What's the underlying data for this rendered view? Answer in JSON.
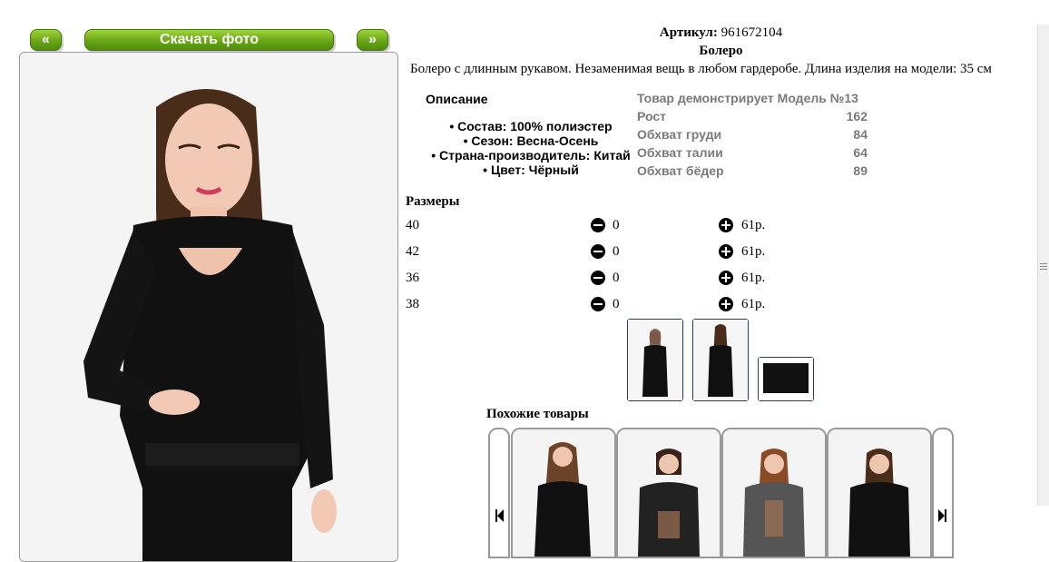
{
  "nav": {
    "prev_label": "«",
    "download_label": "Скачать фото",
    "next_label": "»"
  },
  "product": {
    "article_label": "Артикул:",
    "article_value": "961672104",
    "name": "Болеро",
    "description": "Болеро с длинным рукавом. Незаменимая вещь в любом гардеробе. Длина изделия на модели: 35 см"
  },
  "details": {
    "heading": "Описание",
    "items": [
      "• Состав: 100% полиэстер",
      "• Сезон: Весна-Осень",
      "• Страна-производитель: Китай",
      "• Цвет: Чёрный"
    ]
  },
  "model": {
    "heading": "Товар демонстрирует Модель №13",
    "rows": [
      {
        "label": "Рост",
        "value": "162"
      },
      {
        "label": "Обхват груди",
        "value": "84"
      },
      {
        "label": "Обхват талии",
        "value": "64"
      },
      {
        "label": "Обхват бёдер",
        "value": "89"
      }
    ]
  },
  "sizes": {
    "heading": "Размеры",
    "rows": [
      {
        "size": "40",
        "qty": "0",
        "price": "61р."
      },
      {
        "size": "42",
        "qty": "0",
        "price": "61р."
      },
      {
        "size": "36",
        "qty": "0",
        "price": "61р."
      },
      {
        "size": "38",
        "qty": "0",
        "price": "61р."
      }
    ]
  },
  "similar": {
    "heading": "Похожие товары"
  },
  "colors": {
    "green": "#6aa616",
    "thumb_border": "#1f3d66",
    "grey_text": "#7a7a7a"
  }
}
